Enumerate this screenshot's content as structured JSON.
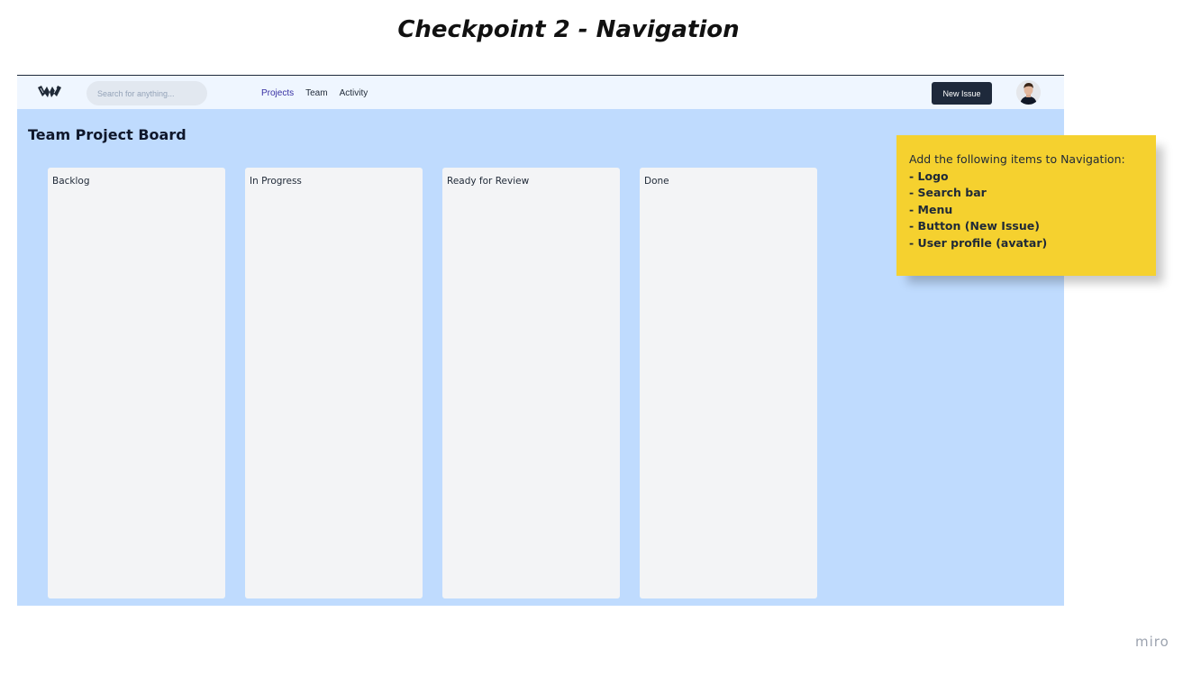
{
  "slide": {
    "title": "Checkpoint 2 - Navigation",
    "watermark": "miro"
  },
  "navbar": {
    "logo_icon": "wing-logo-icon",
    "search": {
      "placeholder": "Search for anything...",
      "value": ""
    },
    "menu": [
      {
        "label": "Projects",
        "active": true
      },
      {
        "label": "Team",
        "active": false
      },
      {
        "label": "Activity",
        "active": false
      }
    ],
    "new_issue_label": "New Issue",
    "avatar_icon": "user-avatar-icon"
  },
  "board": {
    "title": "Team Project Board",
    "columns": [
      {
        "title": "Backlog"
      },
      {
        "title": "In Progress"
      },
      {
        "title": "Ready for Review"
      },
      {
        "title": "Done"
      }
    ]
  },
  "sticky_note": {
    "heading": "Add the following items to Navigation:",
    "items": [
      "- Logo",
      "- Search bar",
      "- Menu",
      "- Button (New Issue)",
      "- User profile (avatar)"
    ],
    "color": "#f5d12f"
  },
  "colors": {
    "frame_bg": "#bfdbfe",
    "navbar_bg": "#eff6ff",
    "button_bg": "#1e293b",
    "active_menu": "#3730a3",
    "column_bg": "#f3f4f6"
  }
}
